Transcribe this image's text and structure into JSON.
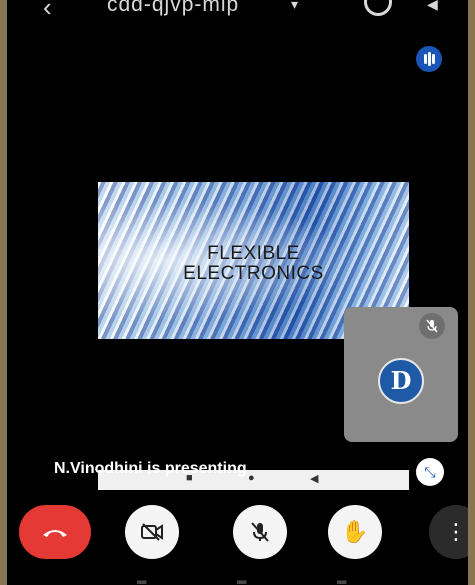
{
  "topbar": {
    "meeting_code": "cdd-qjvp-mip",
    "caret": "▾",
    "back_icon": "arrow-back-icon",
    "switch_camera_icon": "switch-camera-icon",
    "speaker_icon": "speaker-icon"
  },
  "slide": {
    "line1": "FLEXIBLE",
    "line2": "ELECTRONICS"
  },
  "participant": {
    "avatar_letter": "D",
    "mic_muted_icon": "mic-off-icon"
  },
  "presenting_text": "N.Vinodhini is presenting",
  "controls": {
    "end_call_icon": "phone-hangup-icon",
    "camera_icon": "camera-off-icon",
    "mic_icon": "mic-off-icon",
    "hand_icon": "raise-hand-icon",
    "more_icon": "more-vertical-icon"
  },
  "colors": {
    "accent": "#1a56b8",
    "end_call": "#e53935",
    "tile": "#8a8a8a"
  }
}
